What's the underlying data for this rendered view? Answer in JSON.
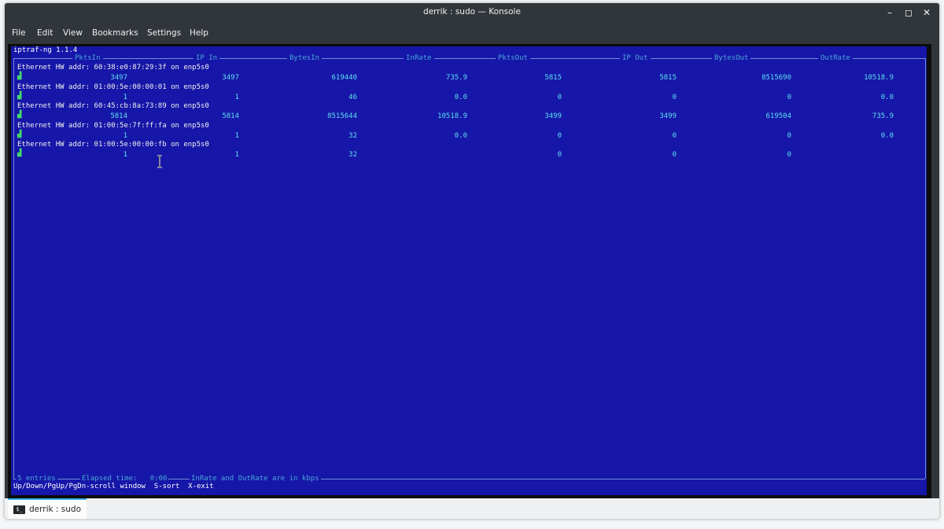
{
  "window": {
    "title": "derrik : sudo — Konsole",
    "buttons": {
      "minimize": "–",
      "maximize": "◻",
      "close": "✕"
    }
  },
  "menubar": {
    "items": [
      "File",
      "Edit",
      "View",
      "Bookmarks",
      "Settings",
      "Help"
    ]
  },
  "terminal": {
    "app_title": "iptraf-ng 1.1.4",
    "columns": [
      "PktsIn",
      "IP In",
      "BytesIn",
      "InRate",
      "PktsOut",
      "IP Out",
      "BytesOut",
      "OutRate"
    ],
    "entries": [
      {
        "addr": "Ethernet HW addr: 60:38:e0:87:29:3f on enp5s0",
        "values": [
          "3497",
          "3497",
          "619440",
          "735.9",
          "5815",
          "5815",
          "8515690",
          "10518.9"
        ]
      },
      {
        "addr": "Ethernet HW addr: 01:00:5e:00:00:01 on enp5s0",
        "values": [
          "1",
          "1",
          "46",
          "0.0",
          "0",
          "0",
          "0",
          "0.0"
        ]
      },
      {
        "addr": "Ethernet HW addr: 60:45:cb:8a:73:89 on enp5s0",
        "values": [
          "5814",
          "5814",
          "8515644",
          "10518.9",
          "3499",
          "3499",
          "619504",
          "735.9"
        ]
      },
      {
        "addr": "Ethernet HW addr: 01:00:5e:7f:ff:fa on enp5s0",
        "values": [
          "1",
          "1",
          "32",
          "0.0",
          "0",
          "0",
          "0",
          "0.0"
        ]
      },
      {
        "addr": "Ethernet HW addr: 01:00:5e:00:00:fb on enp5s0",
        "values": [
          "1",
          "1",
          "32",
          "",
          "0",
          "0",
          "0",
          ""
        ]
      }
    ],
    "footer": {
      "entries": "5 entries",
      "elapsed": "Elapsed time:   0:00",
      "note": "InRate and OutRate are in kbps"
    },
    "help": "Up/Down/PgUp/PgDn-scroll window  S-sort  X-exit",
    "marker_glyph": "▟"
  },
  "tab": {
    "icon": "$_",
    "label": "derrik : sudo"
  },
  "colors": {
    "terminal_bg": "#1616a8",
    "header": "#49a7d8",
    "value": "#5ee0f0",
    "marker": "#41d86b",
    "accent": "#3daee9"
  }
}
